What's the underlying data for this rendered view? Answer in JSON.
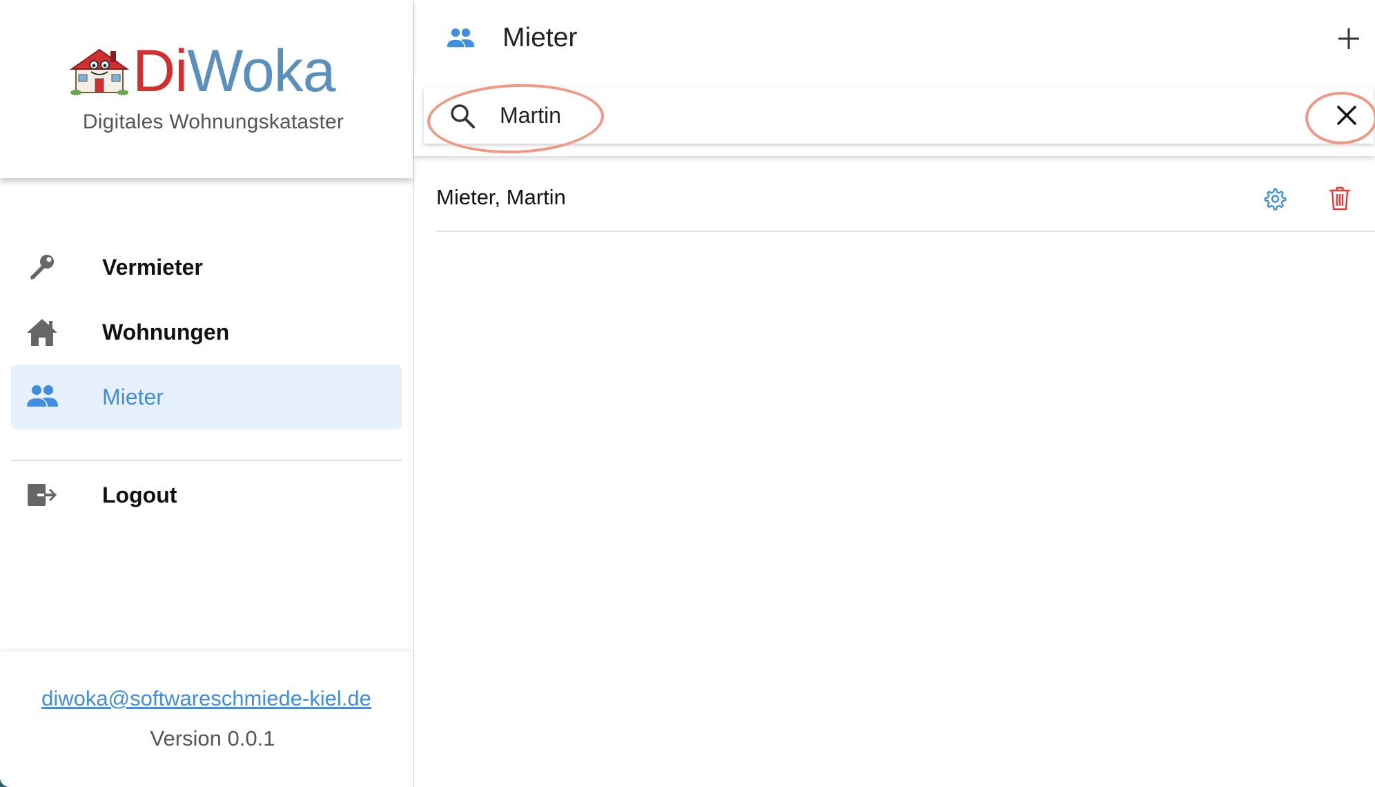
{
  "brand": {
    "name_part1": "Di",
    "name_part2": "Woka",
    "subtitle": "Digitales Wohnungskataster"
  },
  "sidebar": {
    "items": [
      {
        "label": "Vermieter",
        "icon": "key-icon",
        "active": false
      },
      {
        "label": "Wohnungen",
        "icon": "home-icon",
        "active": false
      },
      {
        "label": "Mieter",
        "icon": "people-icon",
        "active": true
      }
    ],
    "logout": {
      "label": "Logout",
      "icon": "logout-icon"
    }
  },
  "footer": {
    "email": "diwoka@softwareschmiede-kiel.de",
    "version": "Version 0.0.1"
  },
  "header": {
    "title": "Mieter",
    "title_icon": "people-icon",
    "add_icon": "plus-icon"
  },
  "search": {
    "value": "Martin",
    "icon": "search-icon",
    "clear_icon": "close-icon"
  },
  "results": [
    {
      "name": "Mieter, Martin",
      "actions": [
        "gear-icon",
        "trash-icon"
      ]
    }
  ],
  "colors": {
    "accent_blue": "#3f8ee0",
    "brand_red": "#d32f2f",
    "brand_blue": "#5b8fbd",
    "active_bg": "#e6f1fd",
    "delete_red": "#e53935",
    "annotation_ring": "#f19884"
  }
}
